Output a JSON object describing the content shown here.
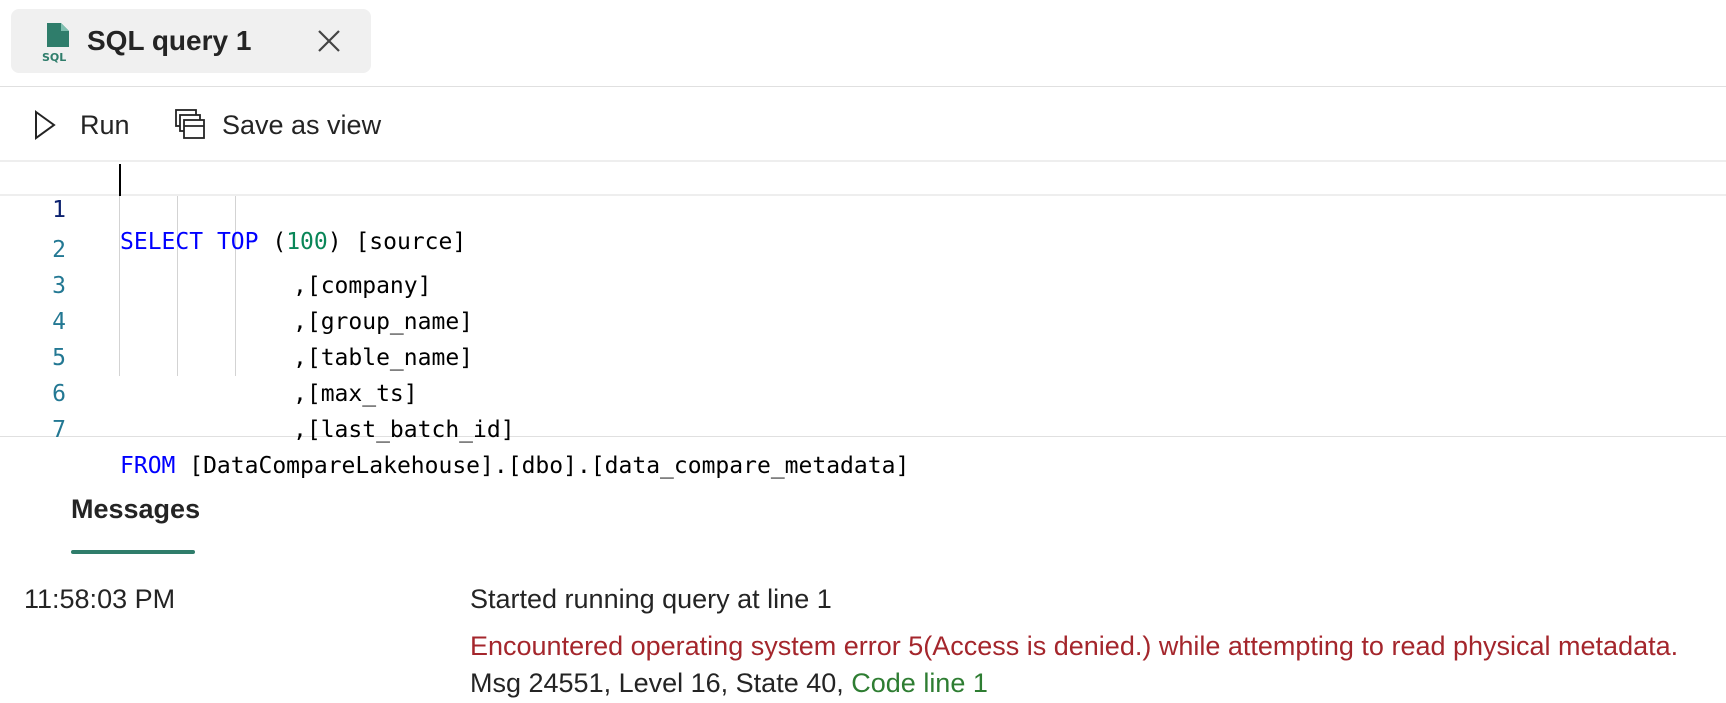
{
  "tab": {
    "label": "SQL query 1",
    "icon_text": "SQL"
  },
  "toolbar": {
    "run_label": "Run",
    "save_view_label": "Save as view"
  },
  "editor": {
    "lines": [
      {
        "number": "1",
        "kw1": "SELECT",
        "kw2": "TOP",
        "open": " (",
        "num": "100",
        "rest": ") [source]"
      },
      {
        "number": "2",
        "text": ",[company]"
      },
      {
        "number": "3",
        "text": ",[group_name]"
      },
      {
        "number": "4",
        "text": ",[table_name]"
      },
      {
        "number": "5",
        "text": ",[max_ts]"
      },
      {
        "number": "6",
        "text": ",[last_batch_id]"
      },
      {
        "number": "7",
        "kw": "FROM",
        "rest": " [DataCompareLakehouse].[dbo].[data_compare_metadata]"
      }
    ]
  },
  "messages": {
    "tab_label": "Messages",
    "time": "11:58:03 PM",
    "started": "Started running query at line 1",
    "error": "Encountered operating system error 5(Access is denied.) while attempting to read physical metadata.",
    "detail": "Msg 24551, Level 16, State 40, ",
    "code_link": "Code line 1"
  },
  "colors": {
    "accent": "#2f7d6b",
    "error": "#a4262c",
    "keyword": "#0000ff",
    "number": "#098658",
    "link": "#2e7d32"
  }
}
